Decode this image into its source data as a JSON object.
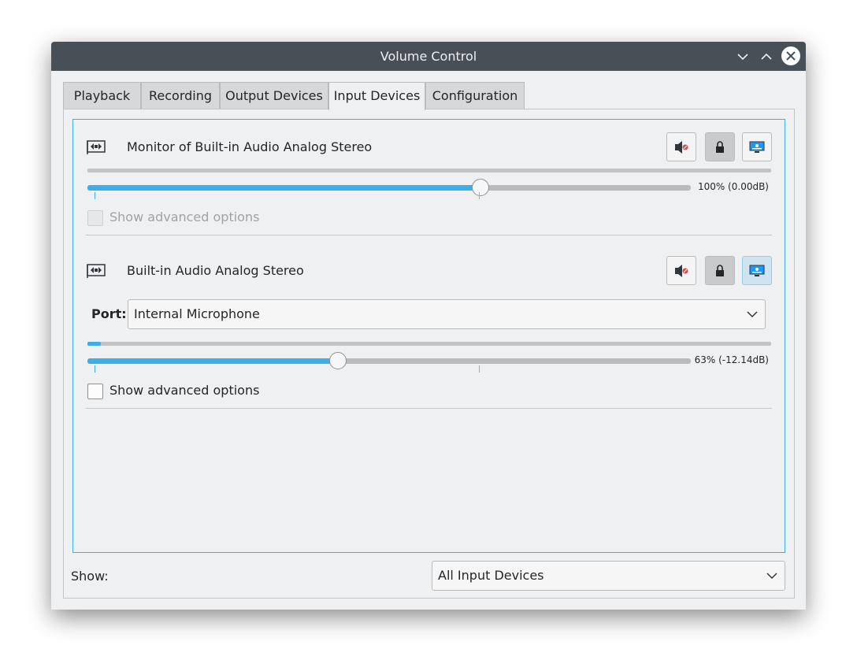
{
  "window": {
    "title": "Volume Control"
  },
  "tabs": [
    {
      "label": "Playback",
      "active": false
    },
    {
      "label": "Recording",
      "active": false
    },
    {
      "label": "Output Devices",
      "active": false
    },
    {
      "label": "Input Devices",
      "active": true
    },
    {
      "label": "Configuration",
      "active": false
    }
  ],
  "devices": [
    {
      "name": "Monitor of Built-in Audio Analog Stereo",
      "level_meter": 0.0,
      "volume_fraction": 0.652,
      "volume_label": "100% (0.00dB)",
      "advanced_label": "Show advanced options",
      "advanced_checked": false,
      "advanced_enabled": false,
      "mute_active": false,
      "lock_active": true,
      "default_active": false
    },
    {
      "name": "Built-in Audio Analog Stereo",
      "port_label": "Port:",
      "port_value": "Internal Microphone",
      "level_meter": 0.02,
      "volume_fraction": 0.415,
      "volume_label": "63% (-12.14dB)",
      "advanced_label": "Show advanced options",
      "advanced_checked": false,
      "advanced_enabled": true,
      "mute_active": false,
      "lock_active": true,
      "default_active": true
    }
  ],
  "footer": {
    "show_label": "Show:",
    "show_value": "All Input Devices"
  },
  "colors": {
    "accent": "#3daee9",
    "titlebar": "#475057",
    "window_bg": "#eff0f1"
  },
  "icons": {
    "window_minimize": "chevron-down-icon",
    "window_maximize": "chevron-up-icon",
    "window_close": "close-icon",
    "device": "sound-card-icon",
    "mute": "mute-speaker-icon",
    "lock": "lock-icon",
    "default": "monitor-icon"
  }
}
